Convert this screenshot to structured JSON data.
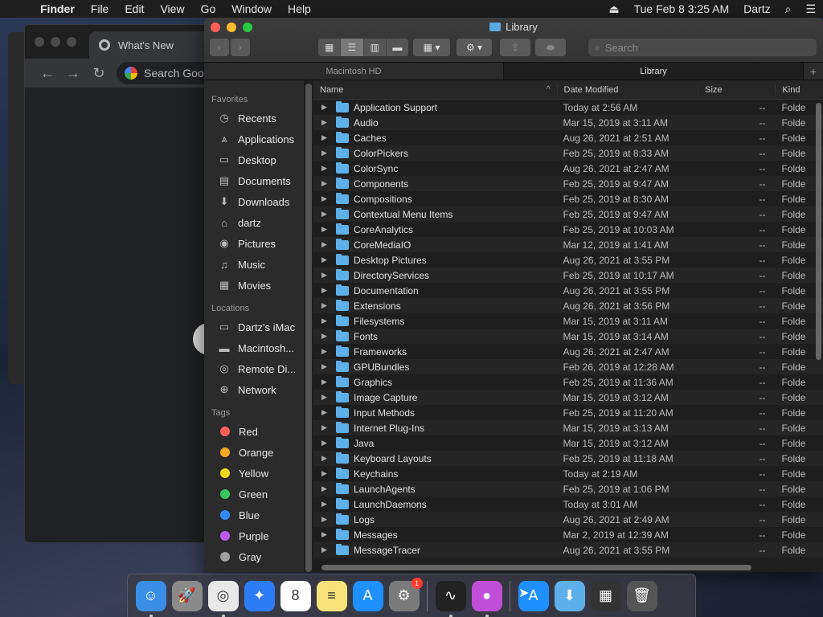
{
  "menubar": {
    "app": "Finder",
    "items": [
      "File",
      "Edit",
      "View",
      "Go",
      "Window",
      "Help"
    ],
    "datetime": "Tue Feb 8  3:25 AM",
    "user": "Dartz"
  },
  "chrome": {
    "tab_title": "What's New",
    "omnibox_placeholder": "Search Goog"
  },
  "finder": {
    "title": "Library",
    "search_placeholder": "Search",
    "path_tabs": [
      "Macintosh HD",
      "Library"
    ],
    "sidebar": {
      "favorites_head": "Favorites",
      "favorites": [
        {
          "label": "Recents",
          "icon": "clock-icon",
          "glyph": "◷"
        },
        {
          "label": "Applications",
          "icon": "applications-icon",
          "glyph": "⩓"
        },
        {
          "label": "Desktop",
          "icon": "desktop-icon",
          "glyph": "▭"
        },
        {
          "label": "Documents",
          "icon": "documents-icon",
          "glyph": "▤"
        },
        {
          "label": "Downloads",
          "icon": "downloads-icon",
          "glyph": "⬇"
        },
        {
          "label": "dartz",
          "icon": "home-icon",
          "glyph": "⌂"
        },
        {
          "label": "Pictures",
          "icon": "pictures-icon",
          "glyph": "◉"
        },
        {
          "label": "Music",
          "icon": "music-icon",
          "glyph": "♫"
        },
        {
          "label": "Movies",
          "icon": "movies-icon",
          "glyph": "▦"
        }
      ],
      "locations_head": "Locations",
      "locations": [
        {
          "label": "Dartz's iMac",
          "icon": "imac-icon",
          "glyph": "▭"
        },
        {
          "label": "Macintosh...",
          "icon": "disk-icon",
          "glyph": "▬"
        },
        {
          "label": "Remote Di...",
          "icon": "remote-disc-icon",
          "glyph": "◎"
        },
        {
          "label": "Network",
          "icon": "network-icon",
          "glyph": "⊕"
        }
      ],
      "tags_head": "Tags",
      "tags": [
        {
          "label": "Red",
          "color": "#ff5f57"
        },
        {
          "label": "Orange",
          "color": "#f5a623"
        },
        {
          "label": "Yellow",
          "color": "#f8d81c"
        },
        {
          "label": "Green",
          "color": "#34c759"
        },
        {
          "label": "Blue",
          "color": "#2f8cf6"
        },
        {
          "label": "Purple",
          "color": "#bf5af2"
        },
        {
          "label": "Gray",
          "color": "#a0a0a0"
        }
      ]
    },
    "columns": {
      "name": "Name",
      "date": "Date Modified",
      "size": "Size",
      "kind": "Kind"
    },
    "rows": [
      {
        "name": "Application Support",
        "date": "Today at 2:56 AM",
        "size": "--",
        "kind": "Folde"
      },
      {
        "name": "Audio",
        "date": "Mar 15, 2019 at 3:11 AM",
        "size": "--",
        "kind": "Folde"
      },
      {
        "name": "Caches",
        "date": "Aug 26, 2021 at 2:51 AM",
        "size": "--",
        "kind": "Folde"
      },
      {
        "name": "ColorPickers",
        "date": "Feb 25, 2019 at 8:33 AM",
        "size": "--",
        "kind": "Folde"
      },
      {
        "name": "ColorSync",
        "date": "Aug 26, 2021 at 2:47 AM",
        "size": "--",
        "kind": "Folde"
      },
      {
        "name": "Components",
        "date": "Feb 25, 2019 at 9:47 AM",
        "size": "--",
        "kind": "Folde"
      },
      {
        "name": "Compositions",
        "date": "Feb 25, 2019 at 8:30 AM",
        "size": "--",
        "kind": "Folde"
      },
      {
        "name": "Contextual Menu Items",
        "date": "Feb 25, 2019 at 9:47 AM",
        "size": "--",
        "kind": "Folde"
      },
      {
        "name": "CoreAnalytics",
        "date": "Feb 25, 2019 at 10:03 AM",
        "size": "--",
        "kind": "Folde"
      },
      {
        "name": "CoreMediaIO",
        "date": "Mar 12, 2019 at 1:41 AM",
        "size": "--",
        "kind": "Folde"
      },
      {
        "name": "Desktop Pictures",
        "date": "Aug 26, 2021 at 3:55 PM",
        "size": "--",
        "kind": "Folde"
      },
      {
        "name": "DirectoryServices",
        "date": "Feb 25, 2019 at 10:17 AM",
        "size": "--",
        "kind": "Folde"
      },
      {
        "name": "Documentation",
        "date": "Aug 26, 2021 at 3:55 PM",
        "size": "--",
        "kind": "Folde"
      },
      {
        "name": "Extensions",
        "date": "Aug 26, 2021 at 3:56 PM",
        "size": "--",
        "kind": "Folde"
      },
      {
        "name": "Filesystems",
        "date": "Mar 15, 2019 at 3:11 AM",
        "size": "--",
        "kind": "Folde"
      },
      {
        "name": "Fonts",
        "date": "Mar 15, 2019 at 3:14 AM",
        "size": "--",
        "kind": "Folde"
      },
      {
        "name": "Frameworks",
        "date": "Aug 26, 2021 at 2:47 AM",
        "size": "--",
        "kind": "Folde"
      },
      {
        "name": "GPUBundles",
        "date": "Feb 26, 2019 at 12:28 AM",
        "size": "--",
        "kind": "Folde"
      },
      {
        "name": "Graphics",
        "date": "Feb 25, 2019 at 11:36 AM",
        "size": "--",
        "kind": "Folde"
      },
      {
        "name": "Image Capture",
        "date": "Mar 15, 2019 at 3:12 AM",
        "size": "--",
        "kind": "Folde"
      },
      {
        "name": "Input Methods",
        "date": "Feb 25, 2019 at 11:20 AM",
        "size": "--",
        "kind": "Folde"
      },
      {
        "name": "Internet Plug-Ins",
        "date": "Mar 15, 2019 at 3:13 AM",
        "size": "--",
        "kind": "Folde"
      },
      {
        "name": "Java",
        "date": "Mar 15, 2019 at 3:12 AM",
        "size": "--",
        "kind": "Folde"
      },
      {
        "name": "Keyboard Layouts",
        "date": "Feb 25, 2019 at 11:18 AM",
        "size": "--",
        "kind": "Folde"
      },
      {
        "name": "Keychains",
        "date": "Today at 2:19 AM",
        "size": "--",
        "kind": "Folde"
      },
      {
        "name": "LaunchAgents",
        "date": "Feb 25, 2019 at 1:06 PM",
        "size": "--",
        "kind": "Folde"
      },
      {
        "name": "LaunchDaemons",
        "date": "Today at 3:01 AM",
        "size": "--",
        "kind": "Folde"
      },
      {
        "name": "Logs",
        "date": "Aug 26, 2021 at 2:49 AM",
        "size": "--",
        "kind": "Folde"
      },
      {
        "name": "Messages",
        "date": "Mar 2, 2019 at 12:39 AM",
        "size": "--",
        "kind": "Folde"
      },
      {
        "name": "MessageTracer",
        "date": "Aug 26, 2021 at 3:55 PM",
        "size": "--",
        "kind": "Folde"
      }
    ]
  },
  "dock": {
    "items": [
      {
        "name": "finder-icon",
        "bg": "#3a8ee6",
        "glyph": "☺",
        "running": true
      },
      {
        "name": "launchpad-icon",
        "bg": "#8a8a8a",
        "glyph": "🚀",
        "running": false
      },
      {
        "name": "chrome-icon",
        "bg": "#e8e8e8",
        "glyph": "◎",
        "running": true
      },
      {
        "name": "safari-icon",
        "bg": "#2d7cf6",
        "glyph": "✦",
        "running": false
      },
      {
        "name": "calendar-icon",
        "bg": "#ffffff",
        "glyph": "8",
        "running": false
      },
      {
        "name": "notes-icon",
        "bg": "#f7e27a",
        "glyph": "≡",
        "running": false
      },
      {
        "name": "app-store-icon",
        "bg": "#1e90ff",
        "glyph": "A",
        "running": false
      },
      {
        "name": "system-preferences-icon",
        "bg": "#7a7a7a",
        "glyph": "⚙",
        "running": false,
        "badge": "1"
      },
      {
        "name": "sep"
      },
      {
        "name": "activity-monitor-icon",
        "bg": "#222",
        "glyph": "∿",
        "running": true
      },
      {
        "name": "installer-icon",
        "bg": "#c04fd8",
        "glyph": "●",
        "running": true
      },
      {
        "name": "sep"
      },
      {
        "name": "app-store-installer-icon",
        "bg": "#1e90ff",
        "glyph": "A",
        "running": false
      },
      {
        "name": "downloads-folder-icon",
        "bg": "#5eb0ea",
        "glyph": "⬇",
        "running": false
      },
      {
        "name": "recent-apps-icon",
        "bg": "#333",
        "glyph": "▦",
        "running": false
      },
      {
        "name": "trash-icon",
        "bg": "#555",
        "glyph": "🗑",
        "running": false
      }
    ]
  }
}
